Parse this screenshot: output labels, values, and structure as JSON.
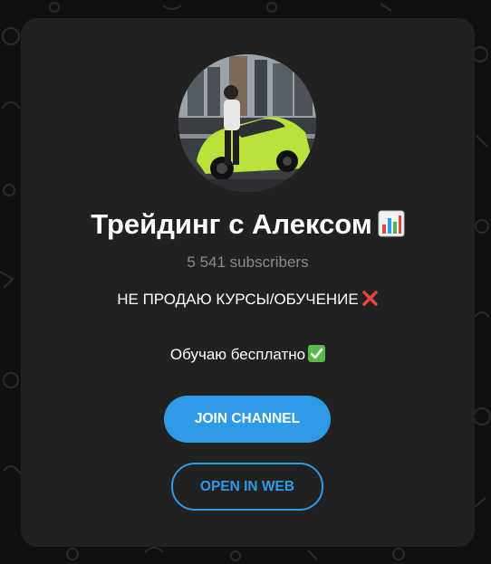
{
  "channel": {
    "title": "Трейдинг с Алексом",
    "title_emoji": "bar-chart-emoji",
    "subscribers": "5 541 subscribers",
    "description_line1": "НЕ ПРОДАЮ КУРСЫ/ОБУЧЕНИЕ",
    "description_line1_emoji": "cross-mark-emoji",
    "description_line2": "Обучаю бесплатно",
    "description_line2_emoji": "check-mark-emoji"
  },
  "buttons": {
    "join_label": "JOIN CHANNEL",
    "web_label": "OPEN IN WEB"
  },
  "colors": {
    "page_bg": "#101010",
    "card_bg": "#212121",
    "accent": "#2f9be8",
    "subtitle": "#8b8b8b",
    "car": "#b9e23a"
  }
}
